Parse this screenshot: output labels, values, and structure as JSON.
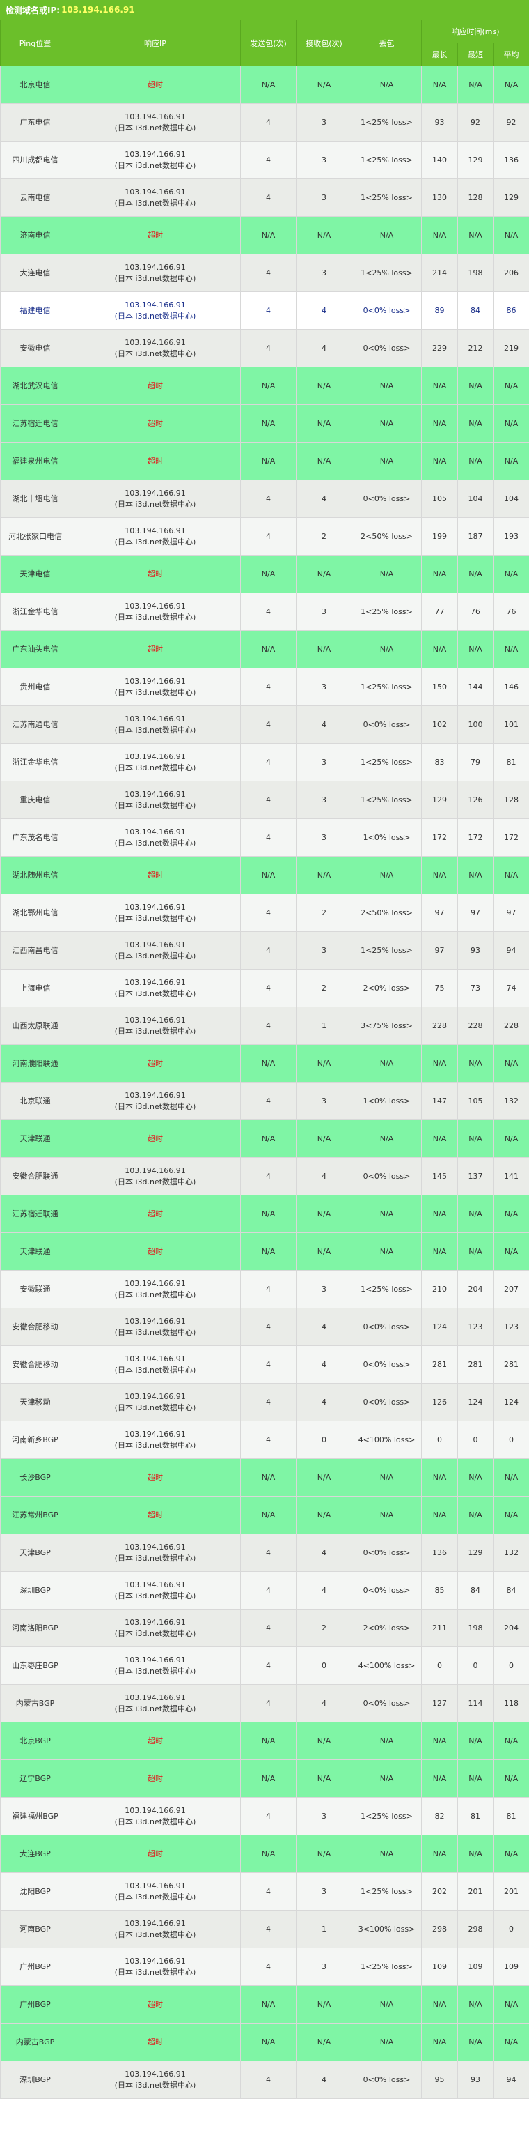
{
  "header": {
    "label": "检测域名或IP:",
    "target": "103.194.166.91"
  },
  "columns": {
    "location": "Ping位置",
    "ip": "响应IP",
    "sent": "发送包(次)",
    "received": "接收包(次)",
    "loss": "丢包",
    "time_group": "响应时间(ms)",
    "max": "最长",
    "min": "最短",
    "avg": "平均"
  },
  "rows": [
    {
      "loc": "北京电信",
      "ip1": "超时",
      "ip2": "",
      "sent": "N/A",
      "recv": "N/A",
      "loss": "N/A",
      "max": "N/A",
      "min": "N/A",
      "avg": "N/A",
      "status": "timeout"
    },
    {
      "loc": "广东电信",
      "ip1": "103.194.166.91",
      "ip2": "(日本 i3d.net数据中心)",
      "sent": "4",
      "recv": "3",
      "loss": "1<25% loss>",
      "max": "93",
      "min": "92",
      "avg": "92",
      "status": "ok"
    },
    {
      "loc": "四川成都电信",
      "ip1": "103.194.166.91",
      "ip2": "(日本 i3d.net数据中心)",
      "sent": "4",
      "recv": "3",
      "loss": "1<25% loss>",
      "max": "140",
      "min": "129",
      "avg": "136",
      "status": "ok"
    },
    {
      "loc": "云南电信",
      "ip1": "103.194.166.91",
      "ip2": "(日本 i3d.net数据中心)",
      "sent": "4",
      "recv": "3",
      "loss": "1<25% loss>",
      "max": "130",
      "min": "128",
      "avg": "129",
      "status": "ok"
    },
    {
      "loc": "济南电信",
      "ip1": "超时",
      "ip2": "",
      "sent": "N/A",
      "recv": "N/A",
      "loss": "N/A",
      "max": "N/A",
      "min": "N/A",
      "avg": "N/A",
      "status": "timeout"
    },
    {
      "loc": "大连电信",
      "ip1": "103.194.166.91",
      "ip2": "(日本 i3d.net数据中心)",
      "sent": "4",
      "recv": "3",
      "loss": "1<25% loss>",
      "max": "214",
      "min": "198",
      "avg": "206",
      "status": "ok"
    },
    {
      "loc": "福建电信",
      "ip1": "103.194.166.91",
      "ip2": "(日本 i3d.net数据中心)",
      "sent": "4",
      "recv": "4",
      "loss": "0<0% loss>",
      "max": "89",
      "min": "84",
      "avg": "86",
      "status": "hl"
    },
    {
      "loc": "安徽电信",
      "ip1": "103.194.166.91",
      "ip2": "(日本 i3d.net数据中心)",
      "sent": "4",
      "recv": "4",
      "loss": "0<0% loss>",
      "max": "229",
      "min": "212",
      "avg": "219",
      "status": "ok"
    },
    {
      "loc": "湖北武汉电信",
      "ip1": "超时",
      "ip2": "",
      "sent": "N/A",
      "recv": "N/A",
      "loss": "N/A",
      "max": "N/A",
      "min": "N/A",
      "avg": "N/A",
      "status": "timeout"
    },
    {
      "loc": "江苏宿迁电信",
      "ip1": "超时",
      "ip2": "",
      "sent": "N/A",
      "recv": "N/A",
      "loss": "N/A",
      "max": "N/A",
      "min": "N/A",
      "avg": "N/A",
      "status": "timeout"
    },
    {
      "loc": "福建泉州电信",
      "ip1": "超时",
      "ip2": "",
      "sent": "N/A",
      "recv": "N/A",
      "loss": "N/A",
      "max": "N/A",
      "min": "N/A",
      "avg": "N/A",
      "status": "timeout"
    },
    {
      "loc": "湖北十堰电信",
      "ip1": "103.194.166.91",
      "ip2": "(日本 i3d.net数据中心)",
      "sent": "4",
      "recv": "4",
      "loss": "0<0% loss>",
      "max": "105",
      "min": "104",
      "avg": "104",
      "status": "ok"
    },
    {
      "loc": "河北张家口电信",
      "ip1": "103.194.166.91",
      "ip2": "(日本 i3d.net数据中心)",
      "sent": "4",
      "recv": "2",
      "loss": "2<50% loss>",
      "max": "199",
      "min": "187",
      "avg": "193",
      "status": "ok"
    },
    {
      "loc": "天津电信",
      "ip1": "超时",
      "ip2": "",
      "sent": "N/A",
      "recv": "N/A",
      "loss": "N/A",
      "max": "N/A",
      "min": "N/A",
      "avg": "N/A",
      "status": "timeout"
    },
    {
      "loc": "浙江金华电信",
      "ip1": "103.194.166.91",
      "ip2": "(日本 i3d.net数据中心)",
      "sent": "4",
      "recv": "3",
      "loss": "1<25% loss>",
      "max": "77",
      "min": "76",
      "avg": "76",
      "status": "ok"
    },
    {
      "loc": "广东汕头电信",
      "ip1": "超时",
      "ip2": "",
      "sent": "N/A",
      "recv": "N/A",
      "loss": "N/A",
      "max": "N/A",
      "min": "N/A",
      "avg": "N/A",
      "status": "timeout"
    },
    {
      "loc": "贵州电信",
      "ip1": "103.194.166.91",
      "ip2": "(日本 i3d.net数据中心)",
      "sent": "4",
      "recv": "3",
      "loss": "1<25% loss>",
      "max": "150",
      "min": "144",
      "avg": "146",
      "status": "ok"
    },
    {
      "loc": "江苏南通电信",
      "ip1": "103.194.166.91",
      "ip2": "(日本 i3d.net数据中心)",
      "sent": "4",
      "recv": "4",
      "loss": "0<0% loss>",
      "max": "102",
      "min": "100",
      "avg": "101",
      "status": "ok"
    },
    {
      "loc": "浙江金华电信",
      "ip1": "103.194.166.91",
      "ip2": "(日本 i3d.net数据中心)",
      "sent": "4",
      "recv": "3",
      "loss": "1<25% loss>",
      "max": "83",
      "min": "79",
      "avg": "81",
      "status": "ok"
    },
    {
      "loc": "重庆电信",
      "ip1": "103.194.166.91",
      "ip2": "(日本 i3d.net数据中心)",
      "sent": "4",
      "recv": "3",
      "loss": "1<25% loss>",
      "max": "129",
      "min": "126",
      "avg": "128",
      "status": "ok"
    },
    {
      "loc": "广东茂名电信",
      "ip1": "103.194.166.91",
      "ip2": "(日本 i3d.net数据中心)",
      "sent": "4",
      "recv": "3",
      "loss": "1<0% loss>",
      "max": "172",
      "min": "172",
      "avg": "172",
      "status": "ok"
    },
    {
      "loc": "湖北随州电信",
      "ip1": "超时",
      "ip2": "",
      "sent": "N/A",
      "recv": "N/A",
      "loss": "N/A",
      "max": "N/A",
      "min": "N/A",
      "avg": "N/A",
      "status": "timeout"
    },
    {
      "loc": "湖北鄂州电信",
      "ip1": "103.194.166.91",
      "ip2": "(日本 i3d.net数据中心)",
      "sent": "4",
      "recv": "2",
      "loss": "2<50% loss>",
      "max": "97",
      "min": "97",
      "avg": "97",
      "status": "ok"
    },
    {
      "loc": "江西南昌电信",
      "ip1": "103.194.166.91",
      "ip2": "(日本 i3d.net数据中心)",
      "sent": "4",
      "recv": "3",
      "loss": "1<25% loss>",
      "max": "97",
      "min": "93",
      "avg": "94",
      "status": "ok"
    },
    {
      "loc": "上海电信",
      "ip1": "103.194.166.91",
      "ip2": "(日本 i3d.net数据中心)",
      "sent": "4",
      "recv": "2",
      "loss": "2<0% loss>",
      "max": "75",
      "min": "73",
      "avg": "74",
      "status": "ok"
    },
    {
      "loc": "山西太原联通",
      "ip1": "103.194.166.91",
      "ip2": "(日本 i3d.net数据中心)",
      "sent": "4",
      "recv": "1",
      "loss": "3<75% loss>",
      "max": "228",
      "min": "228",
      "avg": "228",
      "status": "ok"
    },
    {
      "loc": "河南濮阳联通",
      "ip1": "超时",
      "ip2": "",
      "sent": "N/A",
      "recv": "N/A",
      "loss": "N/A",
      "max": "N/A",
      "min": "N/A",
      "avg": "N/A",
      "status": "timeout"
    },
    {
      "loc": "北京联通",
      "ip1": "103.194.166.91",
      "ip2": "(日本 i3d.net数据中心)",
      "sent": "4",
      "recv": "3",
      "loss": "1<0% loss>",
      "max": "147",
      "min": "105",
      "avg": "132",
      "status": "ok"
    },
    {
      "loc": "天津联通",
      "ip1": "超时",
      "ip2": "",
      "sent": "N/A",
      "recv": "N/A",
      "loss": "N/A",
      "max": "N/A",
      "min": "N/A",
      "avg": "N/A",
      "status": "timeout"
    },
    {
      "loc": "安徽合肥联通",
      "ip1": "103.194.166.91",
      "ip2": "(日本 i3d.net数据中心)",
      "sent": "4",
      "recv": "4",
      "loss": "0<0% loss>",
      "max": "145",
      "min": "137",
      "avg": "141",
      "status": "ok"
    },
    {
      "loc": "江苏宿迁联通",
      "ip1": "超时",
      "ip2": "",
      "sent": "N/A",
      "recv": "N/A",
      "loss": "N/A",
      "max": "N/A",
      "min": "N/A",
      "avg": "N/A",
      "status": "timeout"
    },
    {
      "loc": "天津联通",
      "ip1": "超时",
      "ip2": "",
      "sent": "N/A",
      "recv": "N/A",
      "loss": "N/A",
      "max": "N/A",
      "min": "N/A",
      "avg": "N/A",
      "status": "timeout"
    },
    {
      "loc": "安徽联通",
      "ip1": "103.194.166.91",
      "ip2": "(日本 i3d.net数据中心)",
      "sent": "4",
      "recv": "3",
      "loss": "1<25% loss>",
      "max": "210",
      "min": "204",
      "avg": "207",
      "status": "ok"
    },
    {
      "loc": "安徽合肥移动",
      "ip1": "103.194.166.91",
      "ip2": "(日本 i3d.net数据中心)",
      "sent": "4",
      "recv": "4",
      "loss": "0<0% loss>",
      "max": "124",
      "min": "123",
      "avg": "123",
      "status": "ok"
    },
    {
      "loc": "安徽合肥移动",
      "ip1": "103.194.166.91",
      "ip2": "(日本 i3d.net数据中心)",
      "sent": "4",
      "recv": "4",
      "loss": "0<0% loss>",
      "max": "281",
      "min": "281",
      "avg": "281",
      "status": "ok"
    },
    {
      "loc": "天津移动",
      "ip1": "103.194.166.91",
      "ip2": "(日本 i3d.net数据中心)",
      "sent": "4",
      "recv": "4",
      "loss": "0<0% loss>",
      "max": "126",
      "min": "124",
      "avg": "124",
      "status": "ok"
    },
    {
      "loc": "河南新乡BGP",
      "ip1": "103.194.166.91",
      "ip2": "(日本 i3d.net数据中心)",
      "sent": "4",
      "recv": "0",
      "loss": "4<100% loss>",
      "max": "0",
      "min": "0",
      "avg": "0",
      "status": "ok"
    },
    {
      "loc": "长沙BGP",
      "ip1": "超时",
      "ip2": "",
      "sent": "N/A",
      "recv": "N/A",
      "loss": "N/A",
      "max": "N/A",
      "min": "N/A",
      "avg": "N/A",
      "status": "timeout"
    },
    {
      "loc": "江苏常州BGP",
      "ip1": "超时",
      "ip2": "",
      "sent": "N/A",
      "recv": "N/A",
      "loss": "N/A",
      "max": "N/A",
      "min": "N/A",
      "avg": "N/A",
      "status": "timeout"
    },
    {
      "loc": "天津BGP",
      "ip1": "103.194.166.91",
      "ip2": "(日本 i3d.net数据中心)",
      "sent": "4",
      "recv": "4",
      "loss": "0<0% loss>",
      "max": "136",
      "min": "129",
      "avg": "132",
      "status": "ok"
    },
    {
      "loc": "深圳BGP",
      "ip1": "103.194.166.91",
      "ip2": "(日本 i3d.net数据中心)",
      "sent": "4",
      "recv": "4",
      "loss": "0<0% loss>",
      "max": "85",
      "min": "84",
      "avg": "84",
      "status": "ok"
    },
    {
      "loc": "河南洛阳BGP",
      "ip1": "103.194.166.91",
      "ip2": "(日本 i3d.net数据中心)",
      "sent": "4",
      "recv": "2",
      "loss": "2<0% loss>",
      "max": "211",
      "min": "198",
      "avg": "204",
      "status": "ok"
    },
    {
      "loc": "山东枣庄BGP",
      "ip1": "103.194.166.91",
      "ip2": "(日本 i3d.net数据中心)",
      "sent": "4",
      "recv": "0",
      "loss": "4<100% loss>",
      "max": "0",
      "min": "0",
      "avg": "0",
      "status": "ok"
    },
    {
      "loc": "内蒙古BGP",
      "ip1": "103.194.166.91",
      "ip2": "(日本 i3d.net数据中心)",
      "sent": "4",
      "recv": "4",
      "loss": "0<0% loss>",
      "max": "127",
      "min": "114",
      "avg": "118",
      "status": "ok"
    },
    {
      "loc": "北京BGP",
      "ip1": "超时",
      "ip2": "",
      "sent": "N/A",
      "recv": "N/A",
      "loss": "N/A",
      "max": "N/A",
      "min": "N/A",
      "avg": "N/A",
      "status": "timeout"
    },
    {
      "loc": "辽宁BGP",
      "ip1": "超时",
      "ip2": "",
      "sent": "N/A",
      "recv": "N/A",
      "loss": "N/A",
      "max": "N/A",
      "min": "N/A",
      "avg": "N/A",
      "status": "timeout"
    },
    {
      "loc": "福建福州BGP",
      "ip1": "103.194.166.91",
      "ip2": "(日本 i3d.net数据中心)",
      "sent": "4",
      "recv": "3",
      "loss": "1<25% loss>",
      "max": "82",
      "min": "81",
      "avg": "81",
      "status": "ok"
    },
    {
      "loc": "大连BGP",
      "ip1": "超时",
      "ip2": "",
      "sent": "N/A",
      "recv": "N/A",
      "loss": "N/A",
      "max": "N/A",
      "min": "N/A",
      "avg": "N/A",
      "status": "timeout"
    },
    {
      "loc": "沈阳BGP",
      "ip1": "103.194.166.91",
      "ip2": "(日本 i3d.net数据中心)",
      "sent": "4",
      "recv": "3",
      "loss": "1<25% loss>",
      "max": "202",
      "min": "201",
      "avg": "201",
      "status": "ok"
    },
    {
      "loc": "河南BGP",
      "ip1": "103.194.166.91",
      "ip2": "(日本 i3d.net数据中心)",
      "sent": "4",
      "recv": "1",
      "loss": "3<100% loss>",
      "max": "298",
      "min": "298",
      "avg": "0",
      "status": "ok"
    },
    {
      "loc": "广州BGP",
      "ip1": "103.194.166.91",
      "ip2": "(日本 i3d.net数据中心)",
      "sent": "4",
      "recv": "3",
      "loss": "1<25% loss>",
      "max": "109",
      "min": "109",
      "avg": "109",
      "status": "ok"
    },
    {
      "loc": "广州BGP",
      "ip1": "超时",
      "ip2": "",
      "sent": "N/A",
      "recv": "N/A",
      "loss": "N/A",
      "max": "N/A",
      "min": "N/A",
      "avg": "N/A",
      "status": "timeout"
    },
    {
      "loc": "内蒙古BGP",
      "ip1": "超时",
      "ip2": "",
      "sent": "N/A",
      "recv": "N/A",
      "loss": "N/A",
      "max": "N/A",
      "min": "N/A",
      "avg": "N/A",
      "status": "timeout"
    },
    {
      "loc": "深圳BGP",
      "ip1": "103.194.166.91",
      "ip2": "(日本 i3d.net数据中心)",
      "sent": "4",
      "recv": "4",
      "loss": "0<0% loss>",
      "max": "95",
      "min": "93",
      "avg": "94",
      "status": "ok"
    }
  ]
}
